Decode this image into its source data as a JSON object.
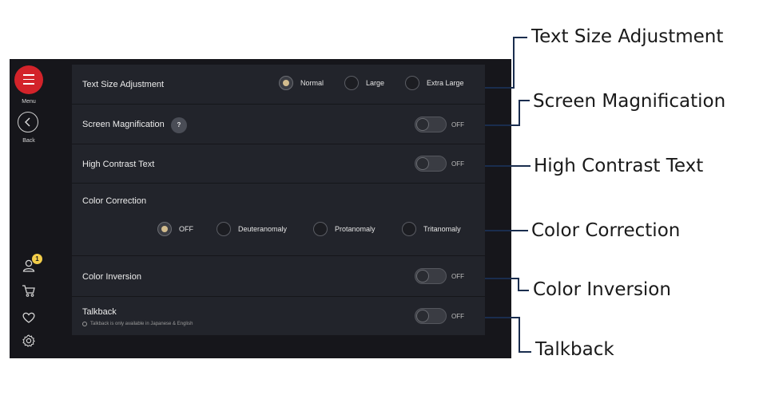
{
  "rail": {
    "menu_label": "Menu",
    "back_label": "Back",
    "badge_count": "1"
  },
  "settings": {
    "text_size": {
      "label": "Text Size Adjustment",
      "options": [
        "Normal",
        "Large",
        "Extra Large"
      ],
      "selected": "Normal"
    },
    "screen_magnification": {
      "label": "Screen Magnification",
      "help": "?",
      "state": "OFF"
    },
    "high_contrast": {
      "label": "High Contrast Text",
      "state": "OFF"
    },
    "color_correction": {
      "label": "Color Correction",
      "options": [
        "OFF",
        "Deuteranomaly",
        "Protanomaly",
        "Tritanomaly"
      ],
      "selected": "OFF"
    },
    "color_inversion": {
      "label": "Color Inversion",
      "state": "OFF"
    },
    "talkback": {
      "label": "Talkback",
      "state": "OFF",
      "note": "Talkback is only available in Japanese & English"
    }
  },
  "callouts": [
    "Text Size Adjustment",
    "Screen Magnification",
    "High Contrast Text",
    "Color Correction",
    "Color Inversion",
    "Talkback"
  ],
  "colors": {
    "menu_button": "#d3232a",
    "badge": "#f2cd4a",
    "radio_selected": "#d2bc8e",
    "callout_line": "#1a2d4e"
  }
}
